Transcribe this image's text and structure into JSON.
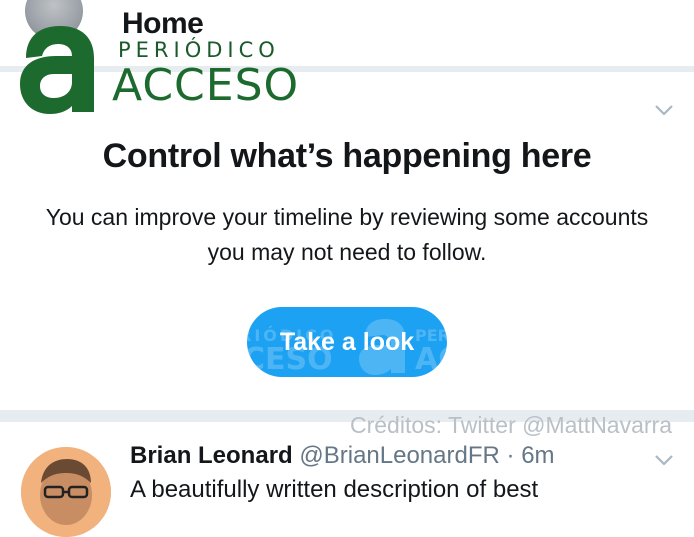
{
  "header": {
    "title": "Home"
  },
  "watermark": {
    "small": "PERIÓDICO",
    "big": "ACCESO",
    "credit": "Créditos: Twitter @MattNavarra"
  },
  "prompt_card": {
    "title": "Control what’s happening here",
    "body": "You can improve your timeline by reviewing some accounts you may not need to follow.",
    "button_label": "Take a look"
  },
  "tweet": {
    "name": "Brian Leonard",
    "handle": "@BrianLeonardFR",
    "separator": "·",
    "time": "6m",
    "text": "A beautifully written description of best"
  },
  "colors": {
    "accent": "#1da1f2",
    "divider": "#e6ecf0",
    "logo_green": "#1d6a2e"
  }
}
